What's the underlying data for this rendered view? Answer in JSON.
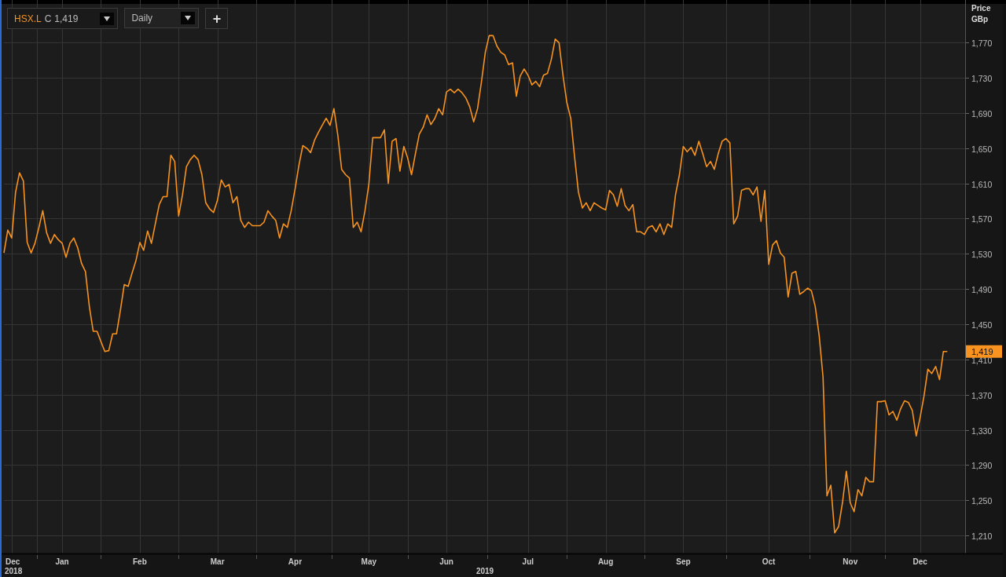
{
  "toolbar": {
    "price_type": "C",
    "price": "1,419",
    "interval": "Daily",
    "add_button": "+"
  },
  "chart": {
    "last_value_label": "1,419",
    "year_labels": [
      "2018",
      "2019"
    ],
    "chart_data": {
      "type": "line",
      "ylabel": "Price GBp",
      "grid": true,
      "ylim": [
        1189.5,
        1814
      ],
      "categories": [
        null,
        null,
        "Dec",
        null,
        null,
        null,
        null,
        null,
        null,
        null,
        null,
        null,
        null,
        null,
        null,
        "Jan",
        null,
        null,
        null,
        null,
        null,
        null,
        null,
        null,
        null,
        null,
        null,
        null,
        null,
        null,
        null,
        null,
        null,
        null,
        null,
        "Feb",
        null,
        null,
        null,
        null,
        null,
        null,
        null,
        null,
        null,
        null,
        null,
        null,
        null,
        null,
        null,
        null,
        null,
        null,
        null,
        "Mar",
        null,
        null,
        null,
        null,
        null,
        null,
        null,
        null,
        null,
        null,
        null,
        null,
        null,
        null,
        null,
        null,
        null,
        null,
        null,
        "Apr",
        null,
        null,
        null,
        null,
        null,
        null,
        null,
        null,
        null,
        null,
        null,
        null,
        null,
        null,
        null,
        null,
        null,
        null,
        "May",
        null,
        null,
        null,
        null,
        null,
        null,
        null,
        null,
        null,
        null,
        null,
        null,
        null,
        null,
        null,
        null,
        null,
        null,
        null,
        "Jun",
        null,
        null,
        null,
        null,
        null,
        null,
        null,
        null,
        null,
        null,
        null,
        null,
        null,
        null,
        null,
        null,
        null,
        null,
        null,
        null,
        "Jul",
        null,
        null,
        null,
        null,
        null,
        null,
        null,
        null,
        null,
        null,
        null,
        null,
        null,
        null,
        null,
        null,
        null,
        null,
        null,
        "Aug",
        null,
        null,
        null,
        null,
        null,
        null,
        null,
        null,
        null,
        null,
        null,
        null,
        null,
        null,
        null,
        null,
        null,
        null,
        null,
        "Sep",
        null,
        null,
        null,
        null,
        null,
        null,
        null,
        null,
        null,
        null,
        null,
        null,
        null,
        null,
        null,
        null,
        null,
        null,
        null,
        null,
        null,
        "Oct",
        null,
        null,
        null,
        null,
        null,
        null,
        null,
        null,
        null,
        null,
        null,
        null,
        null,
        null,
        null,
        null,
        null,
        null,
        null,
        null,
        "Nov",
        null,
        null,
        null,
        null,
        null,
        null,
        null,
        null,
        null,
        null,
        null,
        null,
        null,
        null,
        null,
        null,
        null,
        "Dec",
        null,
        null,
        null,
        null,
        null,
        null,
        null
      ],
      "yticks": [
        {
          "value": 1210,
          "label": "1,210"
        },
        {
          "value": 1250,
          "label": "1,250"
        },
        {
          "value": 1290,
          "label": "1,290"
        },
        {
          "value": 1330,
          "label": "1,330"
        },
        {
          "value": 1370,
          "label": "1,370"
        },
        {
          "value": 1410,
          "label": "1,410"
        },
        {
          "value": 1450,
          "label": "1,450"
        },
        {
          "value": 1490,
          "label": "1,490"
        },
        {
          "value": 1530,
          "label": "1,530"
        },
        {
          "value": 1570,
          "label": "1,570"
        },
        {
          "value": 1610,
          "label": "1,610"
        },
        {
          "value": 1650,
          "label": "1,650"
        },
        {
          "value": 1690,
          "label": "1,690"
        },
        {
          "value": 1730,
          "label": "1,730"
        },
        {
          "value": 1770,
          "label": "1,770"
        }
      ],
      "series": [
        {
          "name": "HSX.L",
          "color": "#f7931e",
          "values": [
            1531,
            1557,
            1548,
            1600,
            1622,
            1613,
            1543,
            1531,
            1542,
            1560,
            1579,
            1554,
            1542,
            1552,
            1546,
            1542,
            1526,
            1542,
            1548,
            1537,
            1519,
            1510,
            1470,
            1442,
            1442,
            1430,
            1419,
            1420,
            1439,
            1439,
            1466,
            1495,
            1493,
            1508,
            1522,
            1543,
            1534,
            1556,
            1542,
            1564,
            1586,
            1595,
            1595,
            1642,
            1635,
            1573,
            1597,
            1629,
            1637,
            1642,
            1637,
            1620,
            1588,
            1581,
            1577,
            1591,
            1614,
            1606,
            1609,
            1588,
            1595,
            1568,
            1560,
            1566,
            1562,
            1562,
            1562,
            1566,
            1579,
            1573,
            1568,
            1548,
            1564,
            1560,
            1579,
            1604,
            1631,
            1653,
            1650,
            1645,
            1659,
            1668,
            1676,
            1684,
            1676,
            1695,
            1665,
            1626,
            1620,
            1616,
            1560,
            1566,
            1555,
            1579,
            1609,
            1662,
            1662,
            1662,
            1671,
            1610,
            1658,
            1661,
            1624,
            1652,
            1639,
            1620,
            1644,
            1666,
            1674,
            1688,
            1677,
            1684,
            1695,
            1688,
            1714,
            1717,
            1713,
            1717,
            1713,
            1707,
            1697,
            1680,
            1695,
            1725,
            1759,
            1778,
            1778,
            1766,
            1759,
            1756,
            1745,
            1747,
            1709,
            1732,
            1740,
            1733,
            1722,
            1726,
            1720,
            1733,
            1735,
            1751,
            1774,
            1770,
            1733,
            1702,
            1684,
            1640,
            1600,
            1582,
            1588,
            1579,
            1588,
            1585,
            1582,
            1580,
            1602,
            1597,
            1584,
            1604,
            1585,
            1579,
            1586,
            1555,
            1555,
            1552,
            1560,
            1562,
            1555,
            1564,
            1552,
            1564,
            1560,
            1597,
            1620,
            1652,
            1646,
            1651,
            1642,
            1658,
            1644,
            1629,
            1635,
            1626,
            1644,
            1658,
            1661,
            1656,
            1564,
            1573,
            1602,
            1604,
            1604,
            1597,
            1606,
            1567,
            1602,
            1518,
            1540,
            1545,
            1531,
            1526,
            1481,
            1508,
            1510,
            1484,
            1487,
            1491,
            1488,
            1470,
            1437,
            1390,
            1255,
            1267,
            1213,
            1220,
            1247,
            1283,
            1247,
            1237,
            1262,
            1255,
            1276,
            1271,
            1271,
            1362,
            1362,
            1363,
            1347,
            1351,
            1341,
            1354,
            1363,
            1361,
            1352,
            1323,
            1344,
            1368,
            1399,
            1394,
            1402,
            1387,
            1419,
            1419
          ]
        }
      ]
    }
  }
}
